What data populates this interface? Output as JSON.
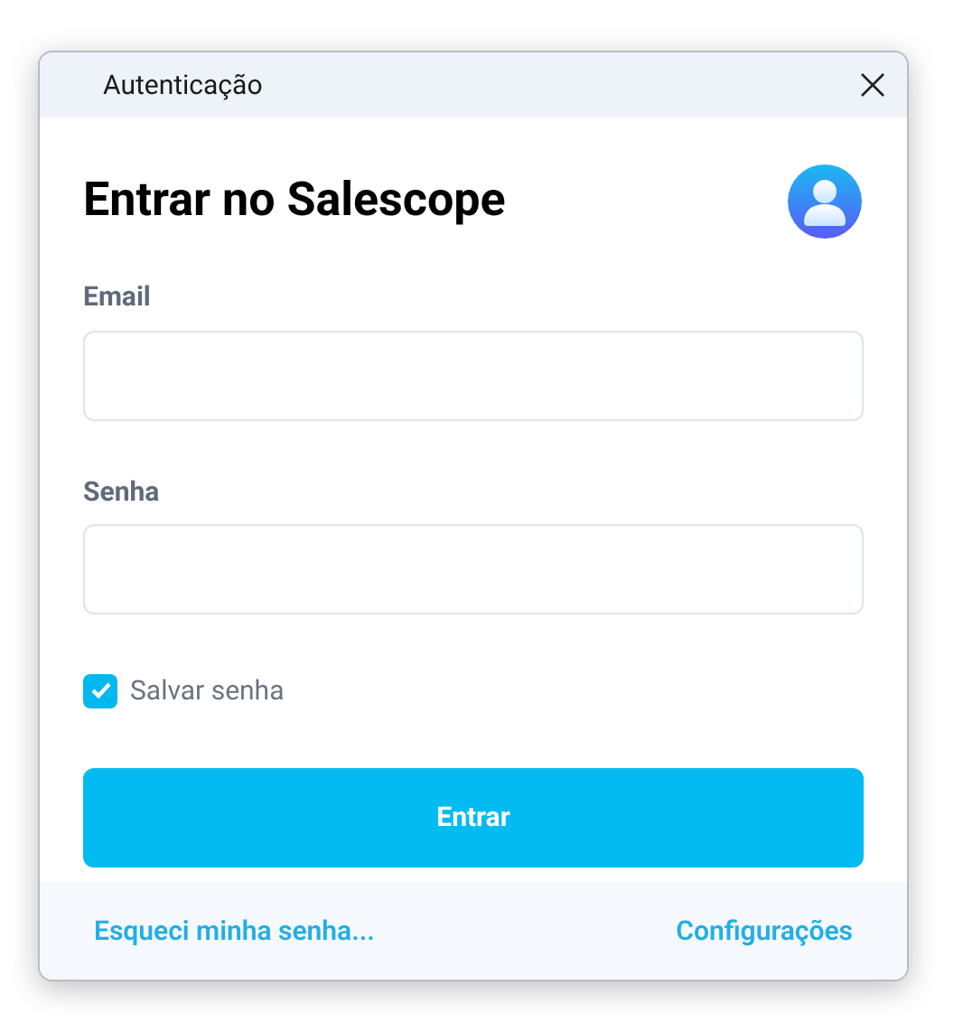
{
  "window": {
    "title": "Autenticação"
  },
  "heading": "Entrar no Salescope",
  "fields": [
    {
      "label": "Email"
    },
    {
      "label": "Senha"
    }
  ],
  "remember": {
    "label": "Salvar senha",
    "checked": true
  },
  "submit": "Entrar",
  "footer_links": [
    "Esqueci minha senha...",
    "Configurações"
  ]
}
